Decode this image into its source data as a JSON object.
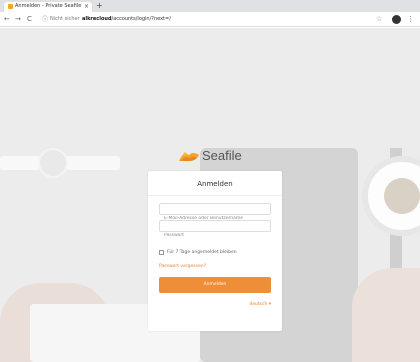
{
  "browser": {
    "tab_title": "Anmelden - Private Seafile",
    "tab_close": "×",
    "new_tab": "+",
    "nav_back": "←",
    "nav_forward": "→",
    "nav_reload": "C",
    "info_icon": "ⓘ",
    "not_secure": "Nicht sicher",
    "url_host": "alkrecloud",
    "url_path": "/accounts/login/?next=/",
    "star_icon": "☆",
    "menu_icon": "⋮"
  },
  "login": {
    "logo_text": "Seafile",
    "title": "Anmelden",
    "username_placeholder": "E-Mail-Adresse oder Benutzername",
    "password_placeholder": "Passwort",
    "remember_label": "Für 7 Tage angemeldet bleiben",
    "forgot_password": "Passwort vergessen?",
    "submit_label": "Anmelden",
    "language_label": "deutsch ▾"
  },
  "colors": {
    "accent": "#ef8e38",
    "link": "#f08030"
  }
}
